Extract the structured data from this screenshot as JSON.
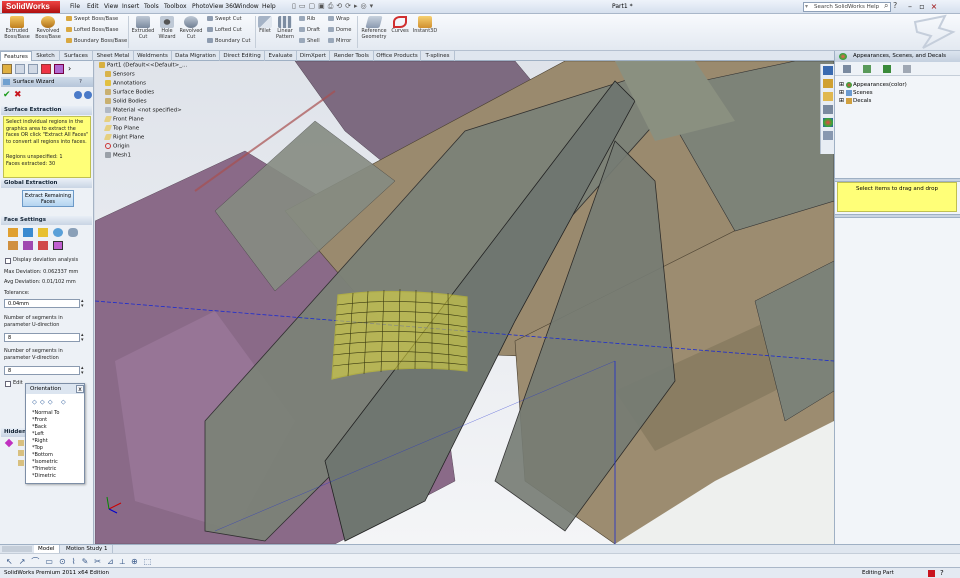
{
  "app": {
    "logo_text": "SolidWorks",
    "menus": [
      "File",
      "Edit",
      "View",
      "Insert",
      "Tools",
      "Toolbox",
      "PhotoView 360",
      "Window",
      "Help"
    ],
    "document_title": "Part1 *",
    "search_placeholder": "Search SolidWorks Help"
  },
  "ribbon": {
    "big_buttons": [
      {
        "label": "Extruded Boss/Base"
      },
      {
        "label": "Revolved Boss/Base"
      },
      {
        "label": "Extruded Cut"
      },
      {
        "label": "Hole Wizard"
      },
      {
        "label": "Revolved Cut"
      },
      {
        "label": "Fillet"
      },
      {
        "label": "Linear Pattern"
      },
      {
        "label": "Reference Geometry"
      },
      {
        "label": "Curves"
      },
      {
        "label": "Instant3D"
      }
    ],
    "small_buttons": [
      {
        "label": "Swept Boss/Base"
      },
      {
        "label": "Lofted Boss/Base"
      },
      {
        "label": "Boundary Boss/Base"
      },
      {
        "label": "Swept Cut"
      },
      {
        "label": "Lofted Cut"
      },
      {
        "label": "Boundary Cut"
      },
      {
        "label": "Rib"
      },
      {
        "label": "Draft"
      },
      {
        "label": "Shell"
      },
      {
        "label": "Wrap"
      },
      {
        "label": "Dome"
      },
      {
        "label": "Mirror"
      }
    ]
  },
  "command_tabs": [
    "Features",
    "Sketch",
    "Surfaces",
    "Sheet Metal",
    "Weldments",
    "Data Migration",
    "Direct Editing",
    "Evaluate",
    "DimXpert",
    "Render Tools",
    "Office Products",
    "T-splines"
  ],
  "active_command_tab": "Features",
  "property_manager": {
    "title": "Surface Wizard",
    "extraction": {
      "heading": "Surface Extraction",
      "message": "Select individual regions in the graphics area to extract the faces OR click \"Extract All Faces\" to convert all regions into faces.",
      "regions_unspecified": "Regions unspecified: 1",
      "faces_extracted": "Faces extracted: 30"
    },
    "global": {
      "heading": "Global Extraction",
      "button": "Extract Remaining Faces"
    },
    "face_settings": {
      "heading": "Face Settings",
      "checkbox_label": "Display deviation analysis",
      "max_deviation": "Max Deviation: 0.062337 mm",
      "avg_deviation": "Avg Deviation: 0.01/102 mm",
      "tolerance_label": "Tolerance:",
      "tolerance_value": "0.04mm",
      "u_label": "Number of segments in parameter U-direction",
      "u_value": "8",
      "v_label": "Number of segments in parameter V-direction",
      "v_value": "8",
      "edit_label": "Edit"
    },
    "hidden_heading": "Hidden"
  },
  "feature_tree": {
    "root": "Part1 (Default<<Default>_...",
    "items": [
      "Sensors",
      "Annotations",
      "Surface Bodies",
      "Solid Bodies",
      "Material <not specified>",
      "Front Plane",
      "Top Plane",
      "Right Plane",
      "Origin",
      "Mesh1"
    ]
  },
  "orientation": {
    "title": "Orientation",
    "close": "x",
    "views": [
      "*Normal To",
      "*Front",
      "*Back",
      "*Left",
      "*Right",
      "*Top",
      "*Bottom",
      "*Isometric",
      "*Trimetric",
      "*Dimetric"
    ]
  },
  "task_pane": {
    "title": "Appearances, Scenes, and Decals",
    "items": [
      "Appearances(color)",
      "Scenes",
      "Decals"
    ],
    "hint": "Select items to drag and drop"
  },
  "bottom_tabs": [
    "Model",
    "Motion Study 1"
  ],
  "status": {
    "left": "SolidWorks Premium 2011 x64 Edition",
    "right": "Editing Part"
  },
  "colors": {
    "accent_red": "#c8141e",
    "yellow_message": "#ffff78",
    "surface_purple": "#8a6a88",
    "surface_tan": "#9a8a6e",
    "surface_gray": "#7c8278",
    "patch_yellow": "#e6e03c"
  }
}
